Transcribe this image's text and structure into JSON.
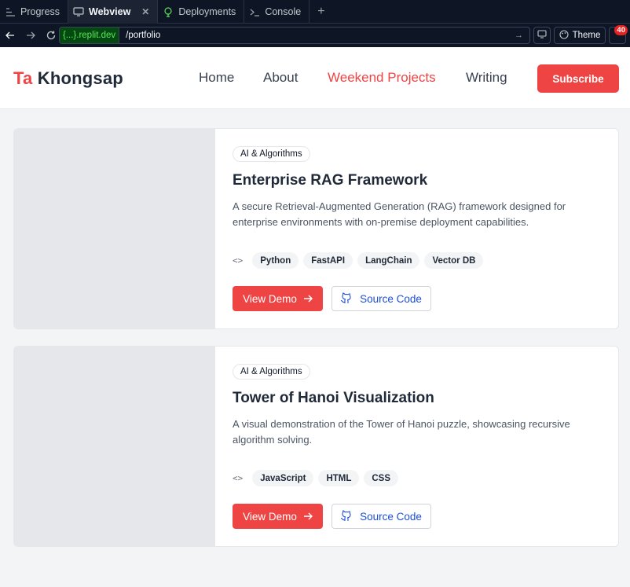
{
  "browser": {
    "tabs": [
      {
        "label": "Progress",
        "icon": "progress-icon"
      },
      {
        "label": "Webview",
        "icon": "monitor-icon",
        "active": true
      },
      {
        "label": "Deployments",
        "icon": "deployments-icon"
      },
      {
        "label": "Console",
        "icon": "terminal-icon"
      }
    ],
    "url_host": "{...}.replit.dev",
    "url_path": "/portfolio",
    "theme_label": "Theme",
    "notification_count": "40"
  },
  "site": {
    "brand_first": "Ta",
    "brand_last": "Khongsap",
    "nav": [
      {
        "label": "Home"
      },
      {
        "label": "About"
      },
      {
        "label": "Weekend Projects",
        "active": true
      },
      {
        "label": "Writing"
      }
    ],
    "subscribe_label": "Subscribe"
  },
  "projects": [
    {
      "category": "AI & Algorithms",
      "title": "Enterprise RAG Framework",
      "description": "A secure Retrieval-Augmented Generation (RAG) framework designed for enterprise environments with on-premise deployment capabilities.",
      "tags": [
        "Python",
        "FastAPI",
        "LangChain",
        "Vector DB"
      ],
      "demo_label": "View Demo",
      "source_label": "Source Code"
    },
    {
      "category": "AI & Algorithms",
      "title": "Tower of Hanoi Visualization",
      "description": "A visual demonstration of the Tower of Hanoi puzzle, showcasing recursive algorithm solving.",
      "tags": [
        "JavaScript",
        "HTML",
        "CSS"
      ],
      "demo_label": "View Demo",
      "source_label": "Source Code"
    }
  ],
  "colors": {
    "accent": "#ef4444",
    "link": "#1d4ed8",
    "chrome_bg": "#0e1525"
  }
}
